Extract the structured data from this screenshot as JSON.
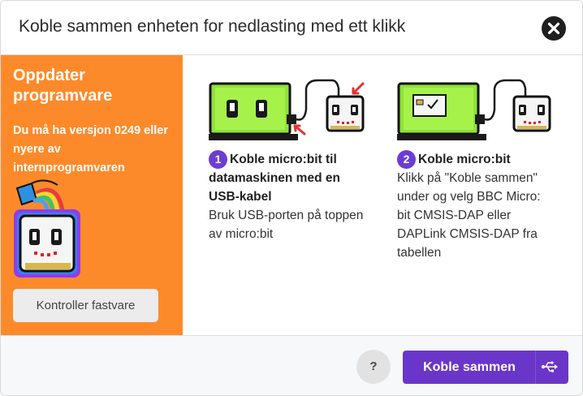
{
  "dialog": {
    "title": "Koble sammen enheten for nedlasting med ett klikk",
    "close_icon": "close-icon"
  },
  "sidebar": {
    "title": "Oppdater programvare",
    "subtitle": "Du må ha versjon 0249 eller nyere av internprogramvaren",
    "firmware_button": "Kontroller fastvare",
    "background_color": "#fd8a2a"
  },
  "steps": [
    {
      "number": "1",
      "title": "Koble micro:bit til datamaskinen med en USB-kabel",
      "description": "Bruk USB-porten på toppen av micro:bit"
    },
    {
      "number": "2",
      "title": "Koble micro:bit",
      "description": "Klikk på \"Koble sammen\" under og velg BBC Micro: bit CMSIS-DAP eller DAPLink CMSIS-DAP fra tabellen"
    }
  ],
  "footer": {
    "help_label": "?",
    "connect_label": "Koble sammen",
    "connect_icon": "usb-icon",
    "accent_color": "#6a36c9"
  }
}
